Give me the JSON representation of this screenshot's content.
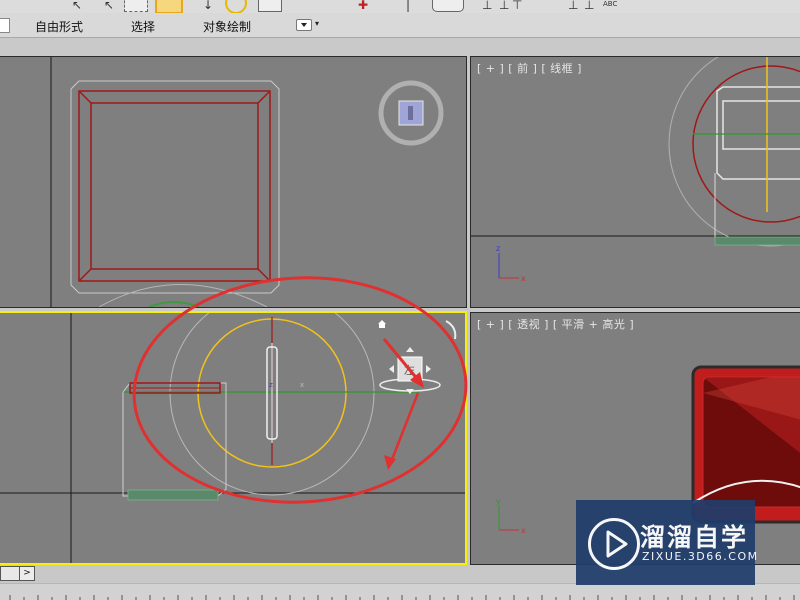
{
  "ribbon": {
    "tabs": [
      {
        "label": "自由形式"
      },
      {
        "label": "选择"
      },
      {
        "label": "对象绘制"
      }
    ]
  },
  "toolbar": {
    "text_tool_label": "ABC",
    "icons": [
      "select-icon",
      "select-region-icon",
      "window-crossing-icon",
      "move-icon",
      "rotate-icon",
      "scale-icon",
      "snap-icon",
      "mirror-icon",
      "align-icon"
    ]
  },
  "viewports": {
    "top_left": {
      "label": ""
    },
    "front": {
      "label": "[ + ] [ 前 ] [ 线框 ]"
    },
    "left": {
      "label": ""
    },
    "perspective": {
      "label": "[ + ] [ 透视 ] [ 平滑 + 高光 ]"
    }
  },
  "axis_labels": {
    "x": "x",
    "y": "y",
    "z": "z"
  },
  "timeline": {
    "next_button": ">"
  },
  "watermark": {
    "title": "溜溜自学",
    "url": "ZIXUE.3D66.COM"
  },
  "colors": {
    "viewport_bg": "#7f7f7f",
    "active_border": "#f5f00a",
    "object_red": "#a01818",
    "selection_yellow": "#f2c21b",
    "annotation_red": "#e03030",
    "grid_line": "#1a1a1a"
  }
}
